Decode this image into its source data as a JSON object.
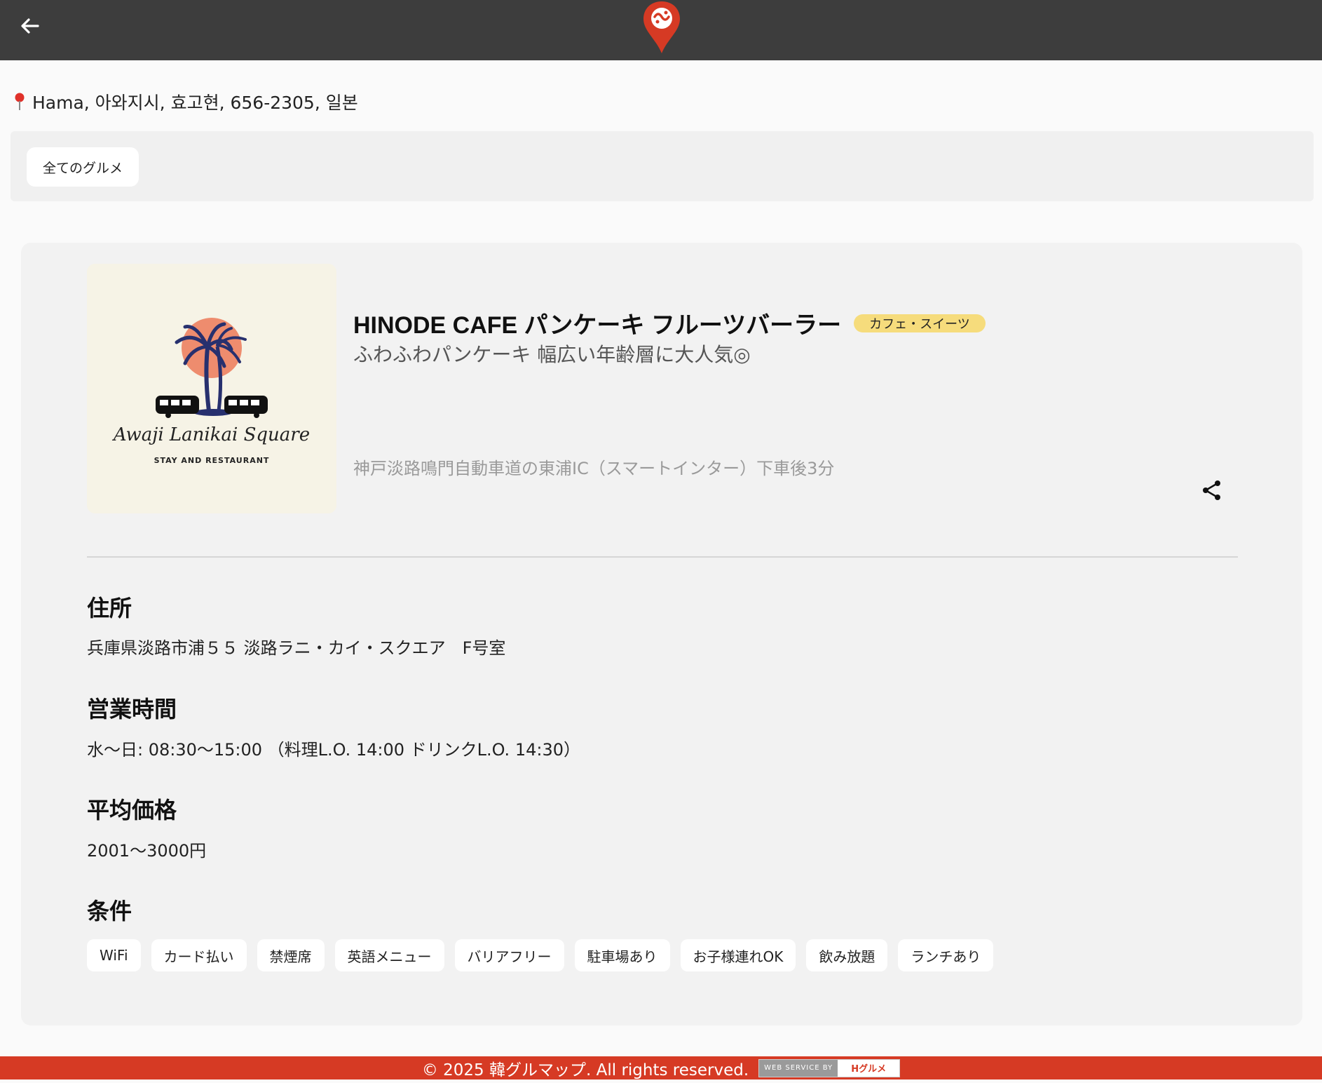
{
  "header": {
    "back_icon": "arrow-left-icon",
    "logo_icon": "map-pin-logo-icon",
    "brand_color": "#d63a24",
    "bar_color": "#3d3d3d"
  },
  "location": {
    "icon": "pin-icon",
    "text": "Hama, 아와지시, 효고현, 656-2305, 일본"
  },
  "filter": {
    "chip_label": "全てのグルメ"
  },
  "shop": {
    "name": "HINODE CAFE パンケーキ フルーツバーラー",
    "category": "カフェ・スイーツ",
    "category_color": "#f6dc7c",
    "catch": "ふわふわパンケーキ 幅広い年齢層に大人気◎",
    "access": "神戸淡路鳴門自動車道の東浦IC（スマートインター）下車後3分",
    "image": {
      "logo_script": "Awaji Lanikai Square",
      "logo_sub": "STAY AND RESTAURANT"
    },
    "share_icon": "share-icon"
  },
  "details": {
    "address_label": "住所",
    "address_value": "兵庫県淡路市浦５５ 淡路ラニ・カイ・スクエア　F号室",
    "hours_label": "営業時間",
    "hours_value": "水〜日: 08:30〜15:00 （料理L.O. 14:00 ドリンクL.O. 14:30）",
    "price_label": "平均価格",
    "price_value": "2001〜3000円",
    "conditions_label": "条件",
    "conditions": [
      "WiFi",
      "カード払い",
      "禁煙席",
      "英語メニュー",
      "バリアフリー",
      "駐車場あり",
      "お子様連れOK",
      "飲み放題",
      "ランチあり"
    ]
  },
  "footer": {
    "copyright": "© 2025 韓グルマップ. All rights reserved.",
    "credit_left": "WEB SERVICE BY",
    "credit_right": "Hグルメ"
  }
}
